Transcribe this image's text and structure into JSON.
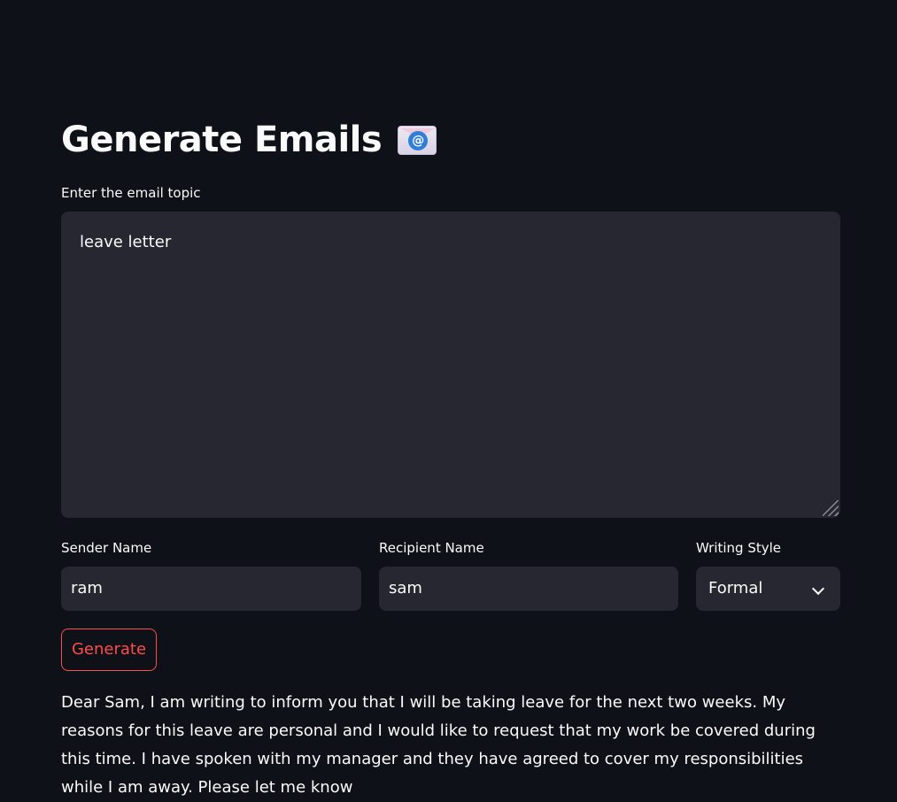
{
  "page": {
    "title": "Generate Emails",
    "title_icon": "email-at-icon"
  },
  "topic": {
    "label": "Enter the email topic",
    "value": "leave letter"
  },
  "sender": {
    "label": "Sender Name",
    "value": "ram"
  },
  "recipient": {
    "label": "Recipient Name",
    "value": "sam"
  },
  "style": {
    "label": "Writing Style",
    "selected": "Formal"
  },
  "generate_button": {
    "label": "Generate"
  },
  "output": {
    "text": "Dear Sam, I am writing to inform you that I will be taking leave for the next two weeks. My reasons for this leave are personal and I would like to request that my work be covered during this time. I have spoken with my manager and they have agreed to cover my responsibilities while I am away. Please let me know"
  },
  "colors": {
    "background": "#0e1117",
    "input_bg": "#262730",
    "accent": "#ff4b4b",
    "text": "#fafafa"
  }
}
